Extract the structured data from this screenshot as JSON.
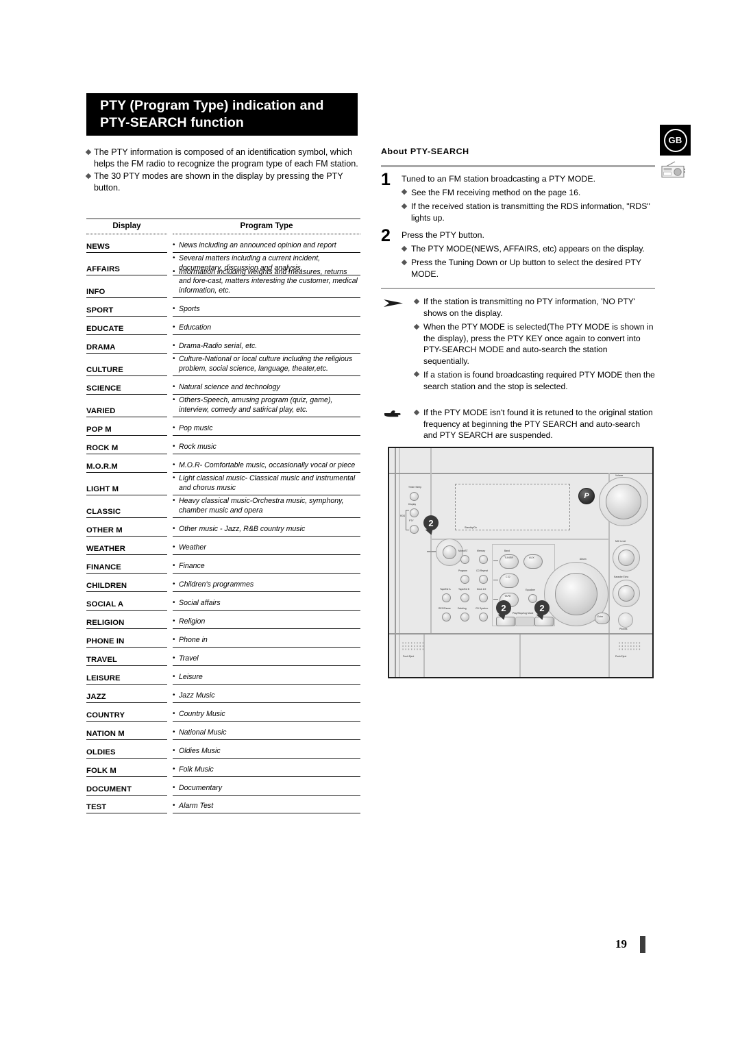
{
  "page": {
    "number": "19",
    "locale_badge": "GB"
  },
  "title": {
    "line1": "PTY (Program Type) indication and",
    "line2": "PTY-SEARCH function"
  },
  "intro": {
    "bullets": [
      "The PTY information is composed of an identification symbol, which helps the FM radio to recognize the program type of each FM station.",
      "The 30 PTY modes are shown in the display by pressing the PTY button."
    ]
  },
  "table": {
    "header": {
      "display": "Display",
      "program_type": "Program Type"
    },
    "rows": [
      {
        "display": "NEWS",
        "type": "News including an announced opinion and report",
        "lines": 1
      },
      {
        "display": "AFFAIRS",
        "type": "Several matters including a current incident, documentary, discussion and analysis.",
        "lines": 2
      },
      {
        "display": "INFO",
        "type": "Information including weights and measures, returns and fore-cast, matters interesting the customer, medical information, etc.",
        "lines": 2
      },
      {
        "display": "SPORT",
        "type": "Sports",
        "lines": 1
      },
      {
        "display": "EDUCATE",
        "type": "Education",
        "lines": 1
      },
      {
        "display": "DRAMA",
        "type": "Drama-Radio serial, etc.",
        "lines": 1
      },
      {
        "display": "CULTURE",
        "type": "Culture-National or local culture including the religious problem, social science, language, theater,etc.",
        "lines": 2
      },
      {
        "display": "SCIENCE",
        "type": "Natural science and technology",
        "lines": 1
      },
      {
        "display": "VARIED",
        "type": "Others-Speech, amusing program (quiz, game), interview, comedy and satirical play, etc.",
        "lines": 2
      },
      {
        "display": "POP M",
        "type": "Pop music",
        "lines": 1
      },
      {
        "display": "ROCK M",
        "type": "Rock music",
        "lines": 1
      },
      {
        "display": "M.O.R.M",
        "type": "M.O.R- Comfortable music, occasionally vocal or piece",
        "lines": 1
      },
      {
        "display": "LIGHT M",
        "type": "Light classical music- Classical music and instrumental and chorus music",
        "lines": 2
      },
      {
        "display": "CLASSIC",
        "type": "Heavy classical  music-Orchestra music, symphony, chamber music and opera",
        "lines": 2
      },
      {
        "display": "OTHER M",
        "type": "Other music - Jazz, R&B country music",
        "lines": 1
      },
      {
        "display": "WEATHER",
        "type": "Weather",
        "lines": 1
      },
      {
        "display": "FINANCE",
        "type": "Finance",
        "lines": 1
      },
      {
        "display": "CHILDREN",
        "type": "Children's programmes",
        "lines": 1
      },
      {
        "display": "SOCIAL  A",
        "type": "Social affairs",
        "lines": 1
      },
      {
        "display": "RELIGION",
        "type": "Religion",
        "lines": 1
      },
      {
        "display": "PHONE IN",
        "type": "Phone in",
        "lines": 1
      },
      {
        "display": "TRAVEL",
        "type": "Travel",
        "lines": 1
      },
      {
        "display": "LEISURE",
        "type": "Leisure",
        "lines": 1
      },
      {
        "display": "JAZZ",
        "type": "Jazz Music",
        "lines": 1
      },
      {
        "display": "COUNTRY",
        "type": "Country Music",
        "lines": 1
      },
      {
        "display": "NATION M",
        "type": "National Music",
        "lines": 1
      },
      {
        "display": "OLDIES",
        "type": "Oldies Music",
        "lines": 1
      },
      {
        "display": "FOLK M",
        "type": "Folk Music",
        "lines": 1
      },
      {
        "display": "DOCUMENT",
        "type": "Documentary",
        "lines": 1
      },
      {
        "display": "TEST",
        "type": "Alarm Test",
        "lines": 1
      }
    ]
  },
  "about": {
    "heading": "About  PTY-SEARCH",
    "steps": [
      {
        "number": "1",
        "lead": "Tuned to an FM station broadcasting a PTY MODE.",
        "bullets": [
          "See the FM receiving method on the page 16.",
          "If the received station is transmitting the RDS information, \"RDS\" lights up."
        ]
      },
      {
        "number": "2",
        "lead": "Press the PTY button.",
        "bullets": [
          "The PTY MODE(NEWS, AFFAIRS, etc) appears on the display.",
          "Press the Tuning Down or Up button to select the desired PTY MODE."
        ]
      }
    ],
    "notes": [
      {
        "icon": "arrow-note-icon",
        "bullets": [
          "If the station is transmitting no PTY information, 'NO PTY' shows on the display.",
          "When the PTY MODE is selected(The PTY MODE is shown in  the display), press the PTY KEY once again to convert into PTY-SEARCH MODE and auto-search the station sequentially.",
          "If a station is found broadcasting required PTY MODE then the search station and the stop is selected."
        ]
      },
      {
        "icon": "pointing-hand-icon",
        "bullets": [
          "If the PTY MODE isn't found it is retuned to the original station frequency at beginning the PTY SEARCH and auto-search and PTY SEARCH are suspended."
        ]
      }
    ]
  },
  "device": {
    "callouts": [
      "2",
      "2",
      "2"
    ],
    "labels": {
      "timer_sleep": "Timer/ Sleep",
      "display": "Display",
      "rds": "RDS",
      "pty": "PTY",
      "standby_on": "Standby/On",
      "mono_st": "Mono/ST",
      "memory": "Memory",
      "program": "Program",
      "cd_repeat": "CD Repeat",
      "tuner_band": "Band",
      "tuner": "TUNER",
      "aux": "AUX",
      "cd": "C D",
      "tape": "TAPE",
      "equalizer": "Equalizer",
      "tape_a": "Tape/Dir A",
      "tape_b": "Tape/Dir B",
      "deck12": "Deck 1/2",
      "rec_pause": "REC/Pause",
      "dubbing": "Dubbing",
      "cd_synchro": "CD Synchro",
      "track_prev": "Track",
      "play_stop": "Play/Stop/Jog Mode",
      "track_next": "Track",
      "volume": "Volume",
      "album": "Album",
      "mic_level": "MIC Level",
      "karaoke_echo": "Karaoke Echo",
      "enter": "Enter",
      "phones": "Phones",
      "push_eject_left": "Push Eject",
      "push_eject_right": "Push Eject",
      "pro_logo": "P"
    }
  }
}
